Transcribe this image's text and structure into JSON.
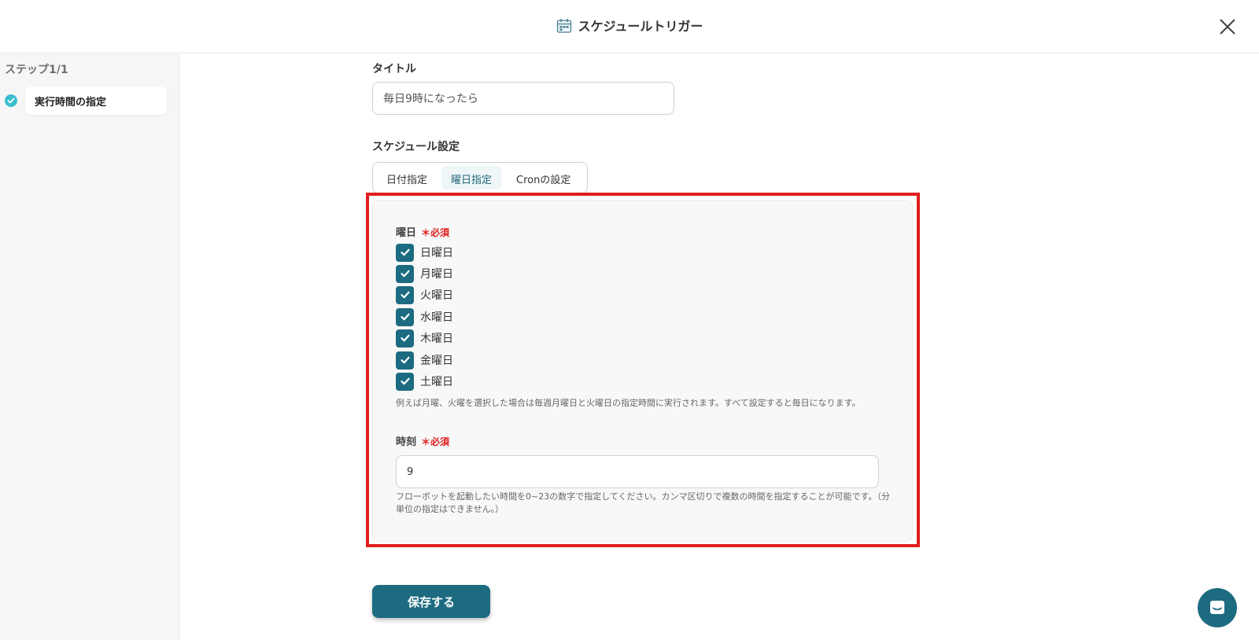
{
  "header": {
    "title": "スケジュールトリガー",
    "icon": "calendar-icon",
    "close_icon": "close-icon"
  },
  "sidebar": {
    "step_label": "ステップ1/1",
    "items": [
      {
        "label": "実行時間の指定",
        "status": "completed"
      }
    ]
  },
  "form": {
    "title_label": "タイトル",
    "title_value": "毎日9時になったら",
    "schedule_label": "スケジュール設定",
    "tabs": [
      {
        "label": "日付指定",
        "active": false
      },
      {
        "label": "曜日指定",
        "active": true
      },
      {
        "label": "Cronの設定",
        "active": false
      }
    ],
    "weekday": {
      "label": "曜日",
      "required": "＊必須",
      "options": [
        {
          "label": "日曜日",
          "checked": true
        },
        {
          "label": "月曜日",
          "checked": true
        },
        {
          "label": "火曜日",
          "checked": true
        },
        {
          "label": "水曜日",
          "checked": true
        },
        {
          "label": "木曜日",
          "checked": true
        },
        {
          "label": "金曜日",
          "checked": true
        },
        {
          "label": "土曜日",
          "checked": true
        }
      ],
      "help": "例えば月曜、火曜を選択した場合は毎週月曜日と火曜日の指定時間に実行されます。すべて設定すると毎日になります。"
    },
    "time": {
      "label": "時刻",
      "required": "＊必須",
      "value": "9",
      "help_line1": "フローボットを起動したい時間を0~23の数字で指定してください。カンマ区切りで複数の時間を指定することが可能です。（分",
      "help_line2": "単位の指定はできません。）"
    },
    "save_label": "保存する"
  },
  "colors": {
    "primary": "#1c6b80",
    "highlight_border": "#e01e1e",
    "required": "#e01e1e",
    "step_check": "#3bbfcf"
  },
  "chat": {
    "icon": "chat-icon"
  }
}
